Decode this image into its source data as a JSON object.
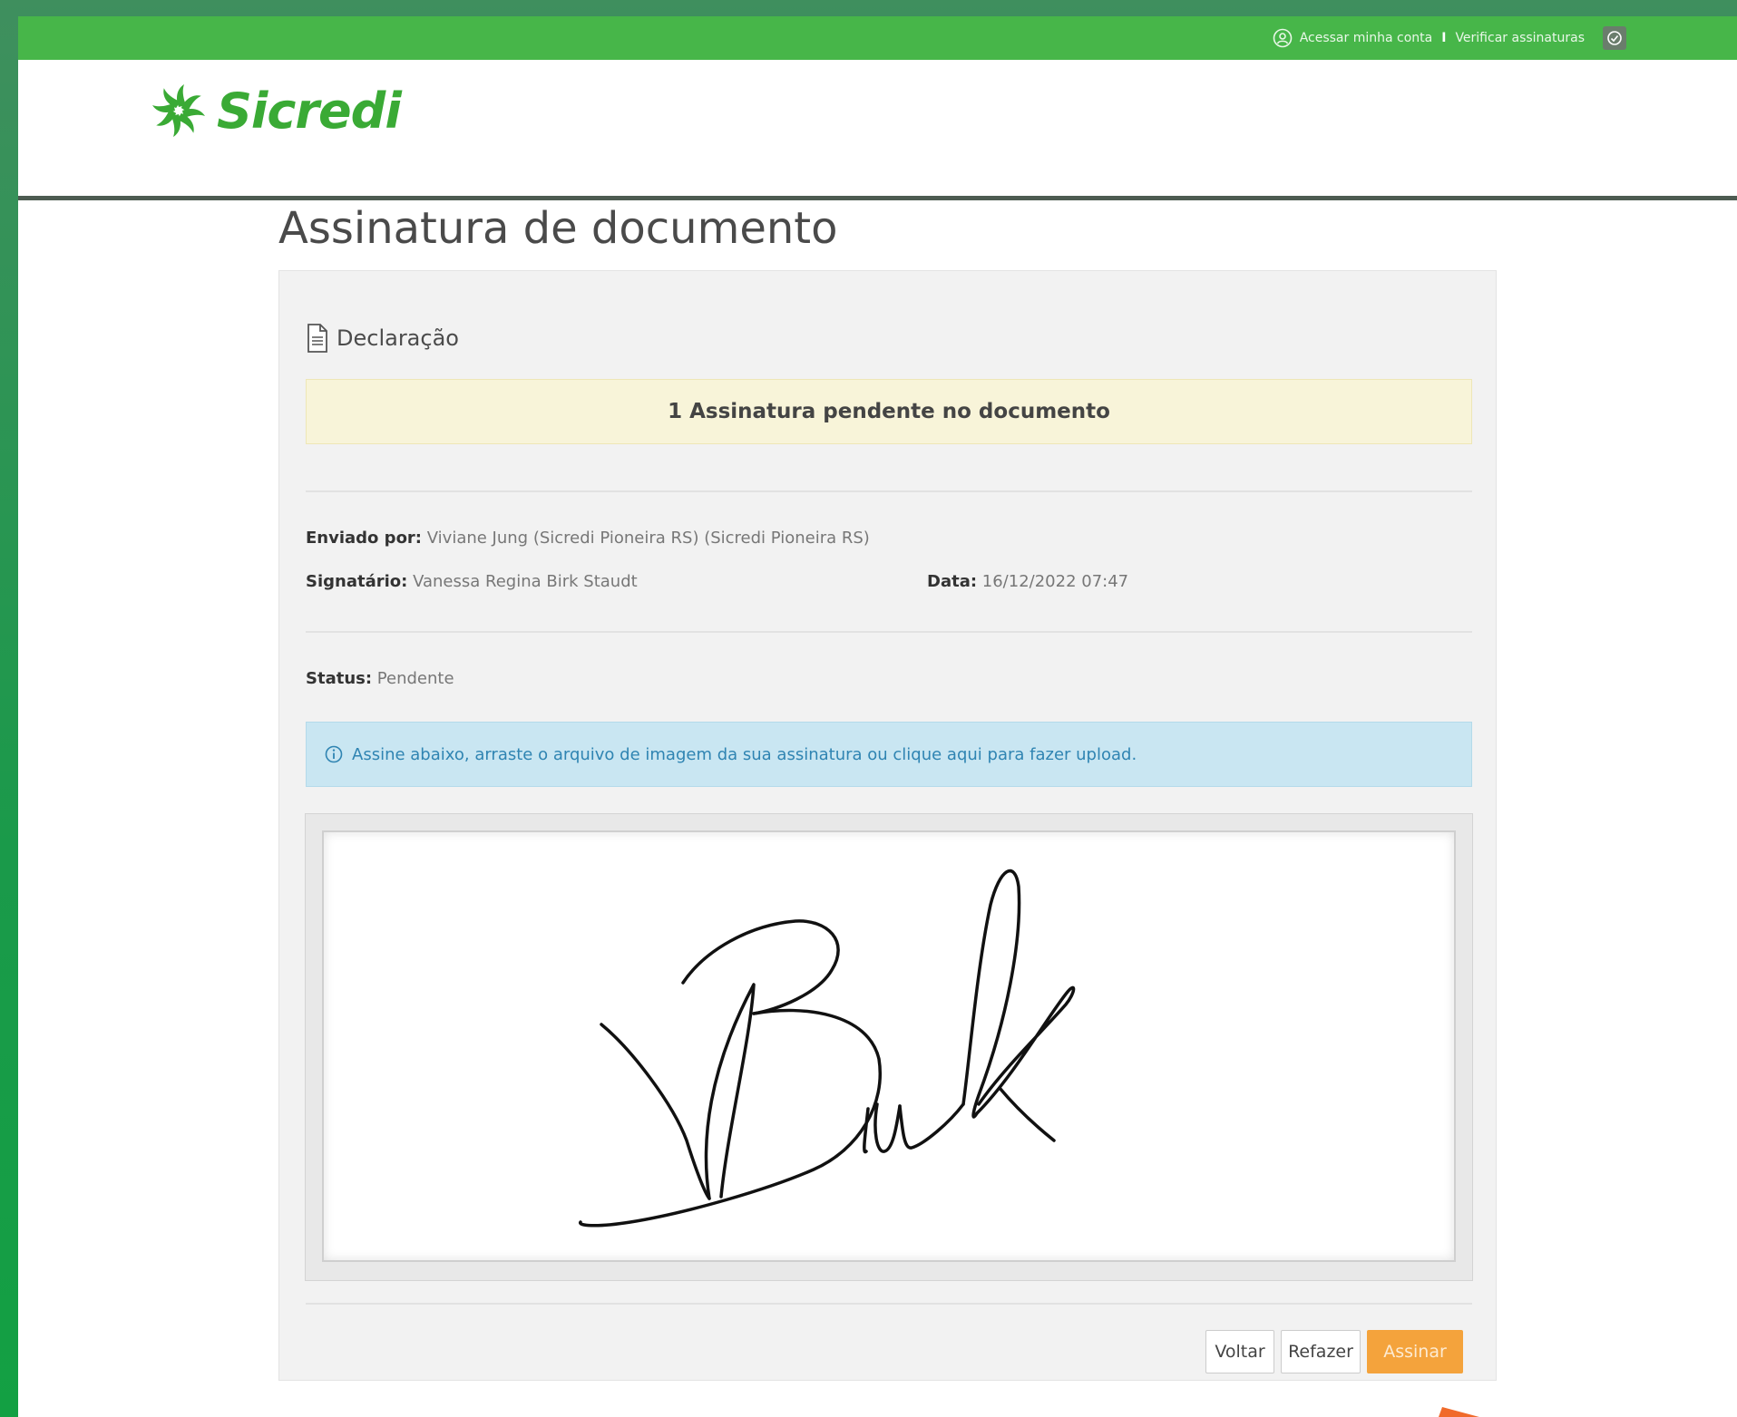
{
  "topbar": {
    "account_link": "Acessar minha conta",
    "separator": "I",
    "verify_link": "Verificar assinaturas"
  },
  "brand": {
    "name": "Sicredi",
    "color": "#3aaa35"
  },
  "page": {
    "title": "Assinatura de documento"
  },
  "document": {
    "icon": "document-icon",
    "name": "Declaração",
    "pending_banner": "1 Assinatura pendente no documento",
    "sent_by_label": "Enviado por:",
    "sent_by_value": "Viviane Jung (Sicredi Pioneira RS) (Sicredi Pioneira RS)",
    "signer_label": "Signatário:",
    "signer_value": "Vanessa Regina Birk Staudt",
    "date_label": "Data:",
    "date_value": "16/12/2022 07:47",
    "status_label": "Status:",
    "status_value": "Pendente"
  },
  "info_banner": {
    "icon": "info-icon",
    "text": "Assine abaixo, arraste o arquivo de imagem da sua assinatura ou clique aqui para fazer upload."
  },
  "actions": {
    "back_label": "Voltar",
    "redo_label": "Refazer",
    "sign_label": "Assinar"
  },
  "colors": {
    "topbar": "#47b649",
    "primary_button": "#f4a33c",
    "warning_banner": "#f8f4d9",
    "info_banner": "#c9e6f2"
  }
}
